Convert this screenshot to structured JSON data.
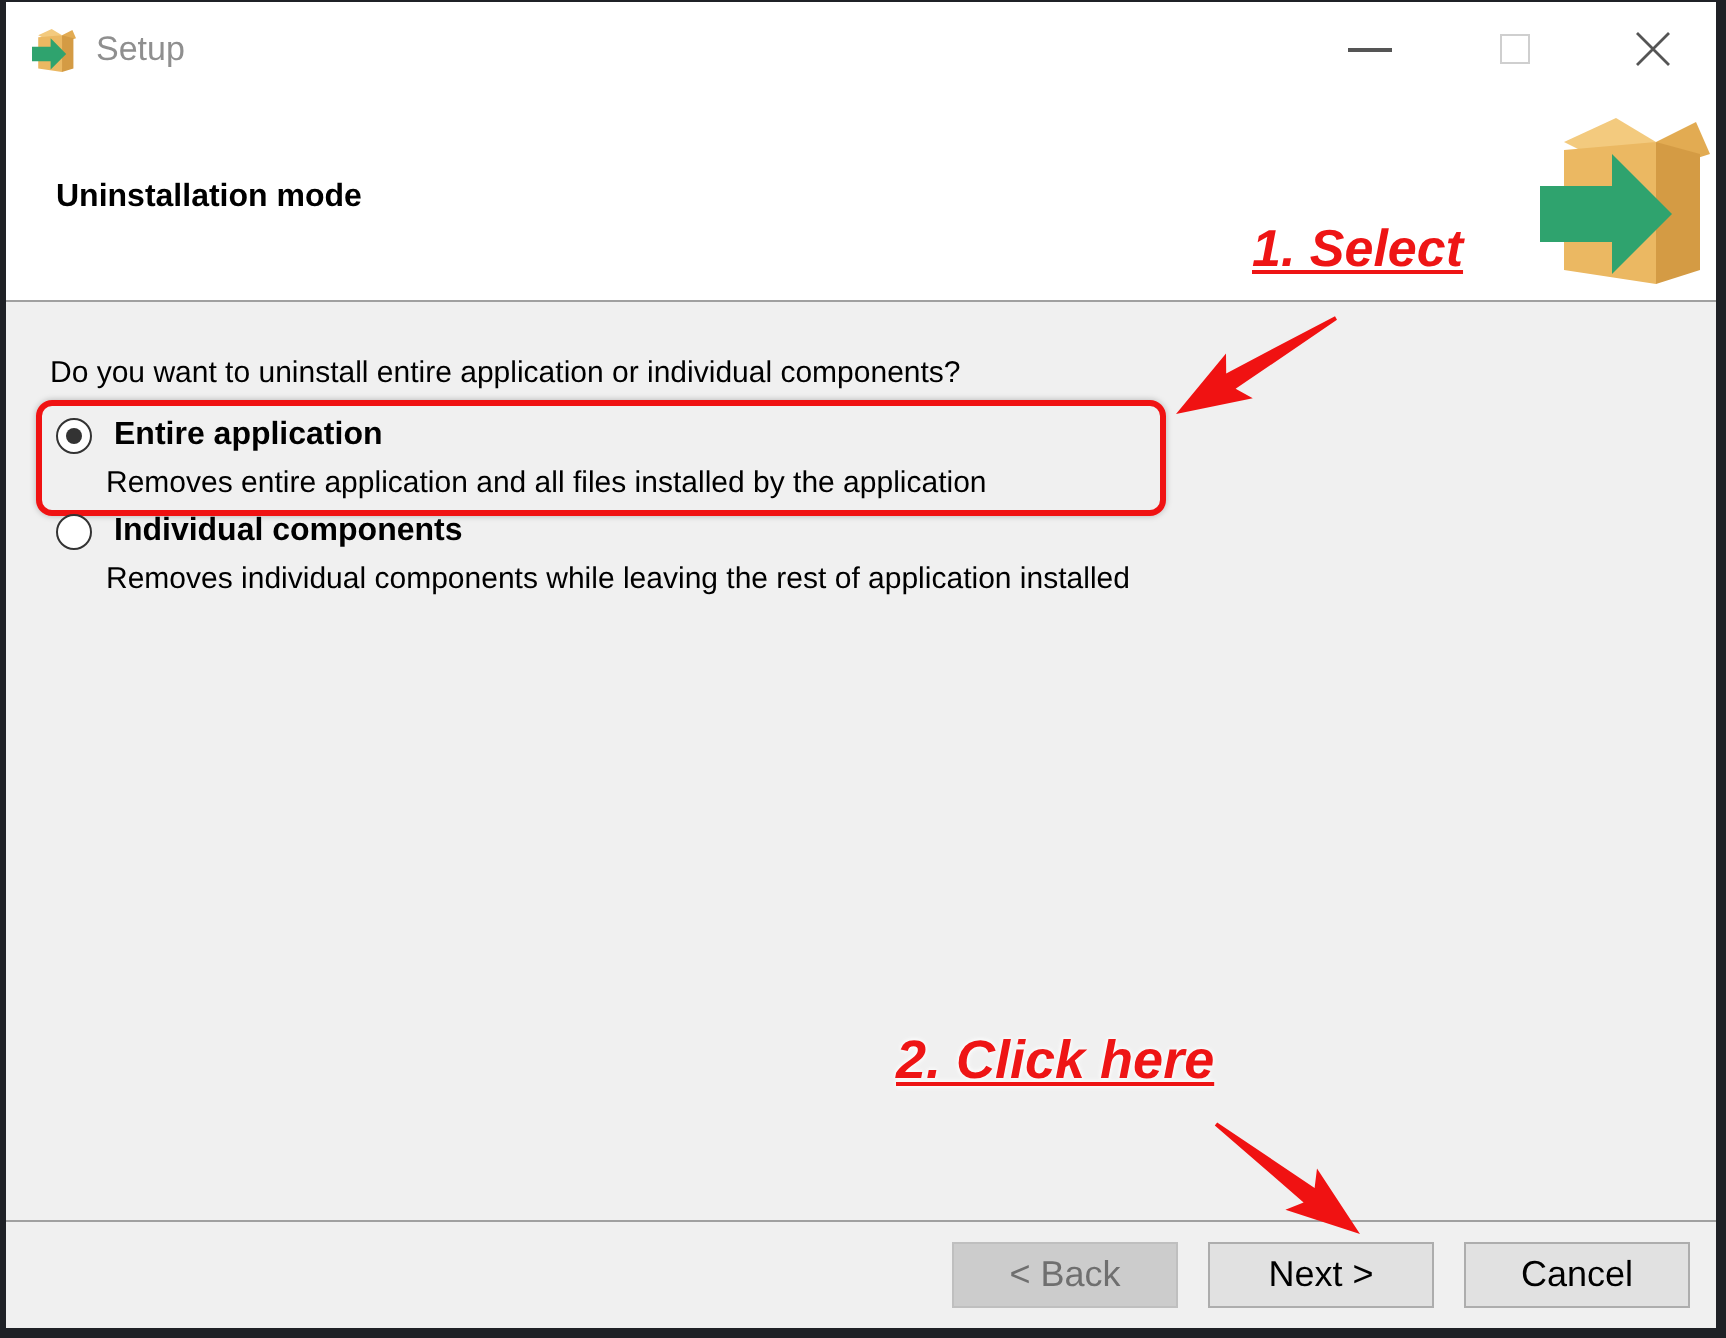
{
  "window": {
    "title": "Setup"
  },
  "header": {
    "title": "Uninstallation mode"
  },
  "body": {
    "question": "Do you want to uninstall entire application or individual components?",
    "options": [
      {
        "label": "Entire application",
        "description": "Removes entire application and all files installed by the application",
        "selected": true,
        "highlighted": true
      },
      {
        "label": "Individual components",
        "description": "Removes individual components while leaving the rest of application installed",
        "selected": false,
        "highlighted": false
      }
    ]
  },
  "buttons": [
    {
      "label": "< Back",
      "disabled": true
    },
    {
      "label": "Next >",
      "disabled": false
    },
    {
      "label": "Cancel",
      "disabled": false
    }
  ],
  "annotations": [
    {
      "kind": "callout",
      "text": "1. Select"
    },
    {
      "kind": "callout",
      "text": "2. Click here"
    }
  ]
}
